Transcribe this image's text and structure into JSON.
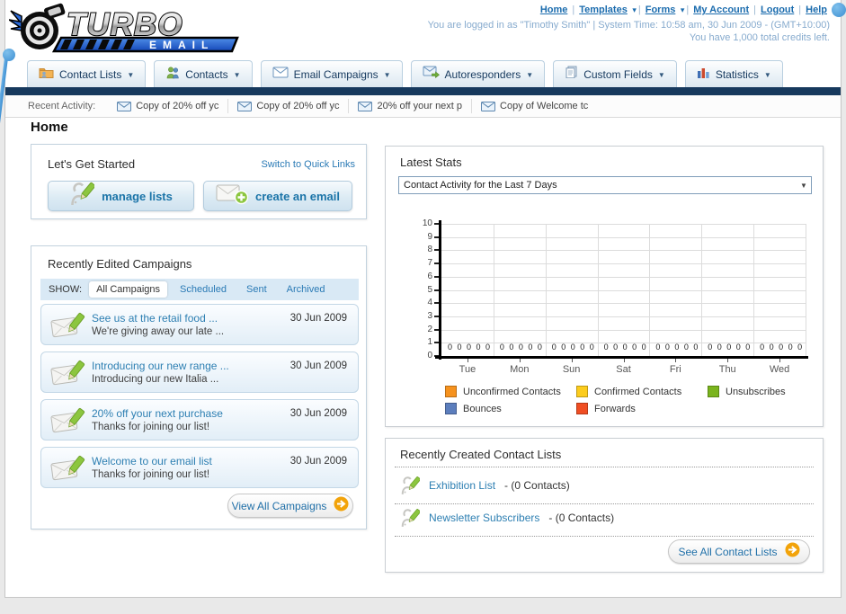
{
  "header": {
    "logo": {
      "title": "TURBO",
      "subtitle": "EMAIL"
    },
    "top_links": [
      {
        "label": "Home",
        "dropdown": false
      },
      {
        "label": "Templates",
        "dropdown": true
      },
      {
        "label": "Forms",
        "dropdown": true
      },
      {
        "label": "My Account",
        "dropdown": false
      },
      {
        "label": "Logout",
        "dropdown": false
      },
      {
        "label": "Help",
        "dropdown": false
      }
    ],
    "login_line1": "You are logged in as \"Timothy Smith\" | System Time: 10:58 am, 30 Jun 2009 - (GMT+10:00)",
    "login_line2": "You have 1,000 total credits left."
  },
  "nav": {
    "tabs": [
      {
        "label": "Contact Lists",
        "icon": "contact-lists-icon"
      },
      {
        "label": "Contacts",
        "icon": "contacts-icon"
      },
      {
        "label": "Email Campaigns",
        "icon": "email-campaigns-icon"
      },
      {
        "label": "Autoresponders",
        "icon": "autoresponders-icon"
      },
      {
        "label": "Custom Fields",
        "icon": "custom-fields-icon"
      },
      {
        "label": "Statistics",
        "icon": "statistics-icon"
      }
    ]
  },
  "recent_activity": {
    "label": "Recent Activity:",
    "items": [
      "Copy of 20% off yc",
      "Copy of 20% off yc",
      "20% off your next p",
      "Copy of Welcome tc"
    ]
  },
  "page_title": "Home",
  "get_started": {
    "title": "Let's Get Started",
    "switch_link": "Switch to Quick Links",
    "buttons": [
      {
        "label": "manage lists",
        "icon": "person-pencil-icon"
      },
      {
        "label": "create an email",
        "icon": "create-email-icon"
      }
    ]
  },
  "campaigns": {
    "title": "Recently Edited Campaigns",
    "show_label": "SHOW:",
    "tabs": [
      {
        "label": "All Campaigns",
        "active": true
      },
      {
        "label": "Scheduled",
        "active": false
      },
      {
        "label": "Sent",
        "active": false
      },
      {
        "label": "Archived",
        "active": false
      }
    ],
    "items": [
      {
        "title": "See us at the retail food ...",
        "subtitle": "We're giving away our late ...",
        "date": "30 Jun 2009"
      },
      {
        "title": "Introducing our new range ...",
        "subtitle": "Introducing our new Italia ...",
        "date": "30 Jun 2009"
      },
      {
        "title": "20% off your next purchase",
        "subtitle": "Thanks for joining our list!",
        "date": "30 Jun 2009"
      },
      {
        "title": "Welcome to our email list",
        "subtitle": "Thanks for joining our list!",
        "date": "30 Jun 2009"
      }
    ],
    "view_all_label": "View All Campaigns"
  },
  "latest_stats": {
    "title": "Latest Stats",
    "selector_value": "Contact Activity for the Last 7 Days"
  },
  "chart_data": {
    "type": "bar",
    "title": "Contact Activity for the Last 7 Days",
    "categories": [
      "Tue",
      "Mon",
      "Sun",
      "Sat",
      "Fri",
      "Thu",
      "Wed"
    ],
    "series": [
      {
        "name": "Unconfirmed Contacts",
        "color": "#F6921E",
        "values": [
          0,
          0,
          0,
          0,
          0,
          0,
          0
        ]
      },
      {
        "name": "Confirmed Contacts",
        "color": "#FCCC1D",
        "values": [
          0,
          0,
          0,
          0,
          0,
          0,
          0
        ]
      },
      {
        "name": "Unsubscribes",
        "color": "#7AB41D",
        "values": [
          0,
          0,
          0,
          0,
          0,
          0,
          0
        ]
      },
      {
        "name": "Bounces",
        "color": "#5C7EBD",
        "values": [
          0,
          0,
          0,
          0,
          0,
          0,
          0
        ]
      },
      {
        "name": "Forwards",
        "color": "#F04E23",
        "values": [
          0,
          0,
          0,
          0,
          0,
          0,
          0
        ]
      }
    ],
    "xlabel": "",
    "ylabel": "",
    "ylim": [
      0,
      10
    ],
    "yticks": [
      0,
      1,
      2,
      3,
      4,
      5,
      6,
      7,
      8,
      9,
      10
    ],
    "grid": true,
    "legend_position": "bottom"
  },
  "contact_lists": {
    "title": "Recently Created Contact Lists",
    "items": [
      {
        "name": "Exhibition List",
        "suffix": "- (0 Contacts)"
      },
      {
        "name": "Newsletter Subscribers",
        "suffix": "- (0 Contacts)"
      }
    ],
    "see_all_label": "See All Contact Lists"
  },
  "colors": {
    "navy_bar": "#17395D",
    "link_blue": "#2A7AB5",
    "arrow_circle_orange": "#F2A30A",
    "pin_blue": "#3D8FD2"
  }
}
